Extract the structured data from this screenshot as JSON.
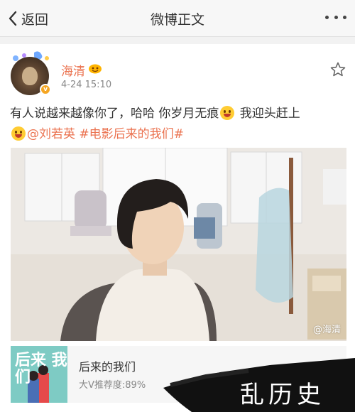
{
  "nav": {
    "back_label": "返回",
    "title": "微博正文"
  },
  "post": {
    "username": "海清",
    "timestamp": "4-24 15:10",
    "text_part1": "有人说越来越像你了，哈哈 你岁月无痕",
    "text_part2": " 我迎头赶上",
    "mention": "@刘若英",
    "hashtag": "#电影后来的我们#",
    "watermark": "@海清"
  },
  "movie": {
    "poster_text": "后来 我们",
    "title": "后来的我们",
    "subtitle": "大V推荐度:89%"
  },
  "site_stamp": "乱历史",
  "colors": {
    "accent": "#eb7350",
    "link": "#eb7350",
    "card_bg": "#ffffff",
    "page_bg": "#f2f2f2",
    "verify": "#f5a623"
  }
}
